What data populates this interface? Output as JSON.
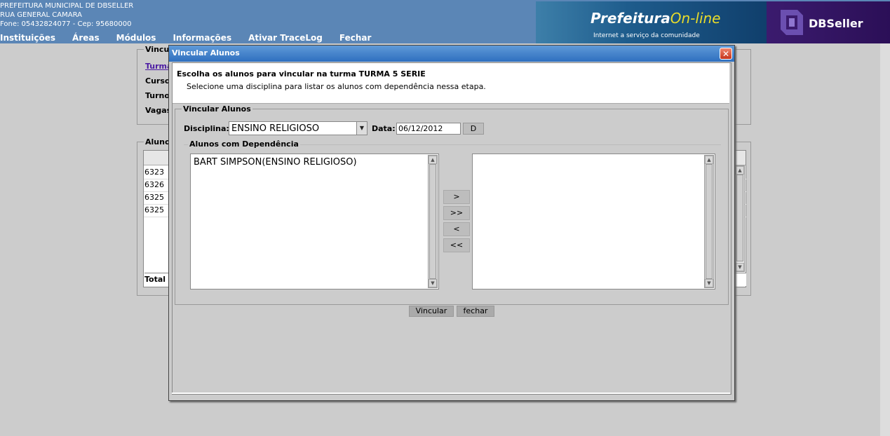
{
  "header": {
    "org_name": "PREFEITURA MUNICIPAL DE DBSELLER",
    "address": "RUA GENERAL CAMARA",
    "phone": "Fone: 05432824077  -  Cep: 95680000",
    "menu": [
      "Instituições",
      "Áreas",
      "Módulos",
      "Informações",
      "Ativar TraceLog",
      "Fechar"
    ],
    "banner_brand_a": "Prefeitura",
    "banner_brand_b": "On-line",
    "banner_tagline": "Internet a serviço da comunidade",
    "dbseller_logo": "DBSeller",
    "colors": {
      "header_bg": "#5b86b6",
      "banner_bg": "#1e5c8c",
      "dbseller_bg": "#2b0f57"
    }
  },
  "background": {
    "top_legend": "Vincu",
    "fields": [
      "Turma",
      "Curso",
      "Turno",
      "Vagas"
    ],
    "lower_legend": "Aluno",
    "rows": [
      "6323",
      "6326",
      "6325",
      "6325"
    ],
    "total_label": "Total"
  },
  "modal": {
    "title": "Vincular Alunos",
    "info_title": "Escolha os alunos para vincular na turma TURMA 5 SERIE",
    "info_sub": "Selecione uma disciplina para listar os alunos com dependência nessa etapa.",
    "fieldset_legend": "Vincular Alunos",
    "disciplina_label": "Disciplina:",
    "disciplina_value": "ENSINO RELIGIOSO",
    "data_label": "Data:",
    "date_value": "06/12/2012",
    "date_button": "D",
    "dep_legend": "Alunos com Dependência",
    "left_list": [
      "BART SIMPSON(ENSINO RELIGIOSO)"
    ],
    "right_list": [],
    "move_buttons": [
      ">",
      ">>",
      "<",
      "<<"
    ],
    "vincular_button": "Vincular",
    "fechar_button": "fechar",
    "close_icon": "close-icon",
    "colors": {
      "title_bg": "#2f6fbf",
      "close_bg": "#c5341c"
    }
  }
}
